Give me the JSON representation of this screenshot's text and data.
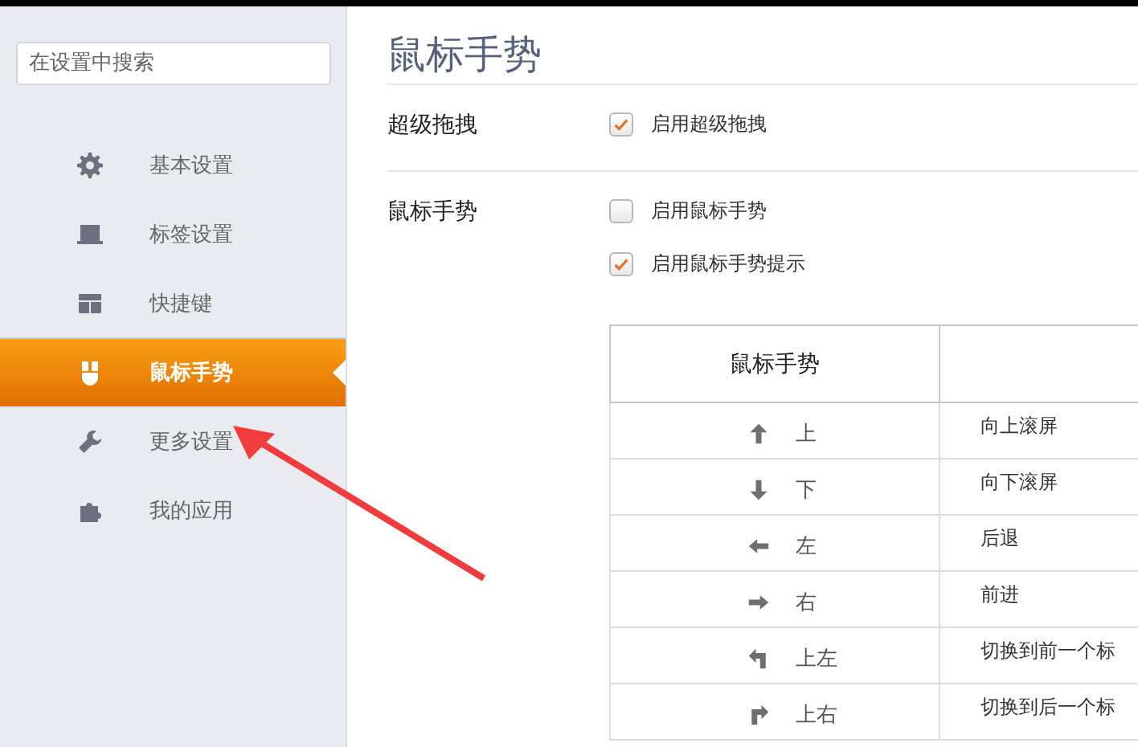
{
  "sidebar": {
    "search": {
      "placeholder": "在设置中搜索"
    },
    "items": [
      {
        "label": "基本设置",
        "kind": "gear",
        "selected": false
      },
      {
        "label": "标签设置",
        "kind": "laptop",
        "selected": false
      },
      {
        "label": "快捷键",
        "kind": "layout",
        "selected": false
      },
      {
        "label": "鼠标手势",
        "kind": "mouse",
        "selected": true
      },
      {
        "label": "更多设置",
        "kind": "wrench",
        "selected": false
      },
      {
        "label": "我的应用",
        "kind": "puzzle",
        "selected": false
      }
    ]
  },
  "main": {
    "title": "鼠标手势",
    "sections": [
      {
        "label": "超级拖拽",
        "options": [
          {
            "label": "启用超级拖拽",
            "checked": true
          }
        ]
      },
      {
        "label": "鼠标手势",
        "options": [
          {
            "label": "启用鼠标手势",
            "checked": false
          },
          {
            "label": "启用鼠标手势提示",
            "checked": true
          }
        ]
      }
    ],
    "table": {
      "columns": [
        "鼠标手势"
      ],
      "rows": [
        {
          "kind": "up",
          "gesture": "上",
          "action": "向上滚屏"
        },
        {
          "kind": "down",
          "gesture": "下",
          "action": "向下滚屏"
        },
        {
          "kind": "left",
          "gesture": "左",
          "action": "后退"
        },
        {
          "kind": "right",
          "gesture": "右",
          "action": "前进"
        },
        {
          "kind": "up-left",
          "gesture": "上左",
          "action": "切换到前一个标"
        },
        {
          "kind": "up-right",
          "gesture": "上右",
          "action": "切换到后一个标"
        }
      ]
    }
  }
}
